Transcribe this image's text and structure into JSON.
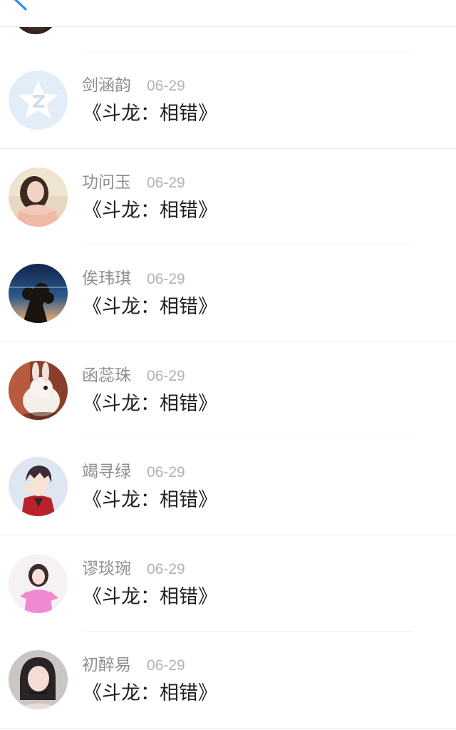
{
  "header": {
    "back_icon": "chevron-left-icon",
    "accent_color": "#2f8cf0"
  },
  "list": {
    "items": [
      {
        "name": "剑涵韵",
        "date": "06-29",
        "message": "《斗龙：相错》",
        "avatar": "qzone-default-avatar"
      },
      {
        "name": "功问玉",
        "date": "06-29",
        "message": "《斗龙：相错》",
        "avatar": "user-photo-avatar"
      },
      {
        "name": "俟玮琪",
        "date": "06-29",
        "message": "《斗龙：相错》",
        "avatar": "sunset-tree-avatar"
      },
      {
        "name": "函蕊珠",
        "date": "06-29",
        "message": "《斗龙：相错》",
        "avatar": "rabbit-avatar"
      },
      {
        "name": "竭寻绿",
        "date": "06-29",
        "message": "《斗龙：相错》",
        "avatar": "anime-boy-avatar"
      },
      {
        "name": "谬琰琬",
        "date": "06-29",
        "message": "《斗龙：相错》",
        "avatar": "pink-girl-avatar"
      },
      {
        "name": "初醉易",
        "date": "06-29",
        "message": "《斗龙：相错》",
        "avatar": "girl-portrait-avatar"
      }
    ]
  }
}
